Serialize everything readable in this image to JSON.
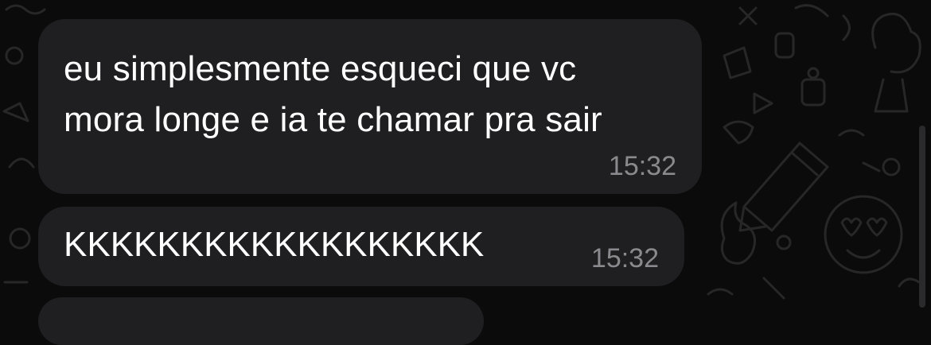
{
  "messages": [
    {
      "text": "eu simplesmente esqueci que vc\nmora longe e ia te chamar pra sair",
      "time": "15:32"
    },
    {
      "text": "KKKKKKKKKKKKKKKKKK",
      "time": "15:32"
    }
  ],
  "colors": {
    "background": "#0b0b0b",
    "bubble": "#1f1f21",
    "text": "#ffffff",
    "timestamp": "#8a8a8e",
    "doodle": "#2b2b2b"
  },
  "icons": [
    "pencil-doodle-icon",
    "heart-face-doodle-icon",
    "flame-doodle-icon",
    "cactus-doodle-icon"
  ]
}
